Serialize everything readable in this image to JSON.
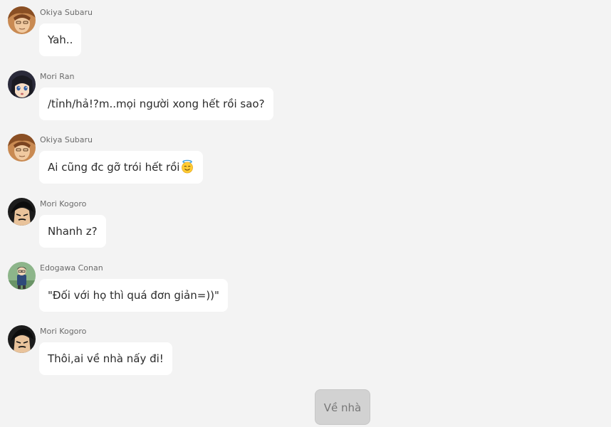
{
  "messages": [
    {
      "sender": "Okiya Subaru",
      "text": "Yah..",
      "avatar_icon": "okiya-subaru-avatar"
    },
    {
      "sender": "Mori Ran",
      "text": "/tỉnh/hả!?m..mọi người xong hết rồi sao?",
      "avatar_icon": "mori-ran-avatar"
    },
    {
      "sender": "Okiya Subaru",
      "text": "Ai cũng đc gỡ trói hết rồi",
      "emoji": "smiling-face-with-halo",
      "avatar_icon": "okiya-subaru-avatar"
    },
    {
      "sender": "Mori Kogoro",
      "text": "Nhanh z?",
      "avatar_icon": "mori-kogoro-avatar"
    },
    {
      "sender": "Edogawa Conan",
      "text": "\"Đối với họ thì quá đơn giản=))\"",
      "avatar_icon": "edogawa-conan-avatar"
    },
    {
      "sender": "Mori Kogoro",
      "text": "Thôi,ai về nhà nấy đi!",
      "avatar_icon": "mori-kogoro-avatar"
    }
  ],
  "choice_button": {
    "label": "Về nhà"
  },
  "colors": {
    "background": "#f3f3f3",
    "bubble": "#ffffff",
    "button": "#d2d2d2"
  }
}
